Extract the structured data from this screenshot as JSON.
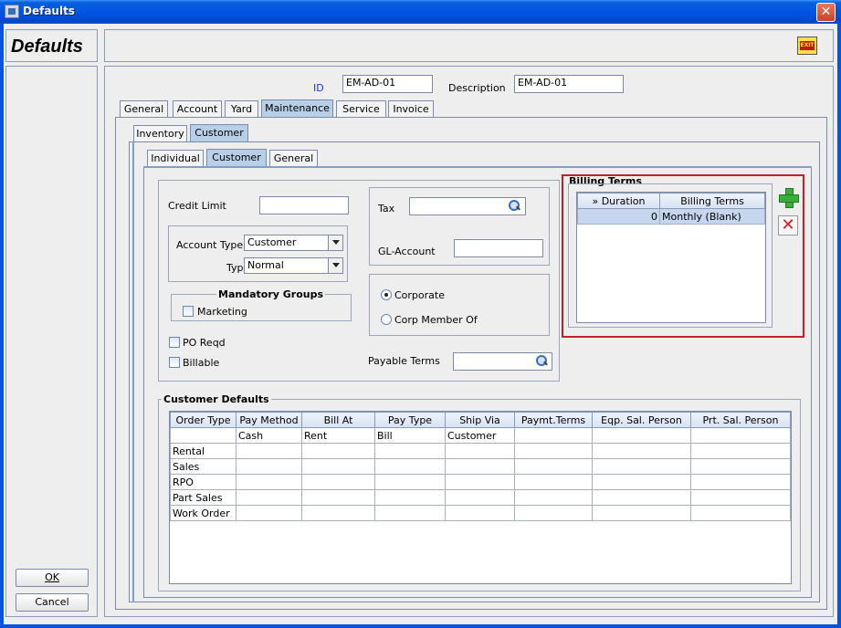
{
  "window": {
    "title": "Defaults"
  },
  "header": {
    "form_title": "Defaults",
    "exit_label": "EXIT"
  },
  "left": {
    "ok_label": "OK",
    "cancel_label": "Cancel"
  },
  "record": {
    "id_label": "ID",
    "id_value": "EM-AD-01",
    "description_label": "Description",
    "description_value": "EM-AD-01"
  },
  "main_tabs": [
    "General",
    "Account",
    "Yard",
    "Maintenance",
    "Service",
    "Invoice"
  ],
  "sub_tabs": [
    "Inventory",
    "Customer"
  ],
  "inner_tabs": [
    "Individual",
    "Customer",
    "General"
  ],
  "form": {
    "credit_limit_label": "Credit Limit",
    "credit_limit_value": "",
    "account_type_label": "Account Type",
    "account_type_value": "Customer",
    "type_label": "Type",
    "type_value": "Normal",
    "mandatory_groups_label": "Mandatory Groups",
    "marketing_label": "Marketing",
    "po_reqd_label": "PO Reqd",
    "billable_label": "Billable",
    "tax_label": "Tax",
    "tax_value": "",
    "gl_account_label": "GL-Account",
    "gl_account_value": "",
    "corporate_label": "Corporate",
    "corp_member_label": "Corp Member Of",
    "payable_terms_label": "Payable Terms",
    "payable_terms_value": ""
  },
  "billing_terms": {
    "title": "Billing Terms",
    "columns": [
      "» Duration",
      "Billing Terms"
    ],
    "rows": [
      {
        "duration": "0",
        "terms": "Monthly (Blank)"
      }
    ]
  },
  "customer_defaults": {
    "title": "Customer Defaults",
    "columns": [
      "Order Type",
      "Pay Method",
      "Bill At",
      "Pay Type",
      "Ship Via",
      "Paymt.Terms",
      "Eqp. Sal. Person",
      "Prt. Sal. Person"
    ],
    "rows": [
      [
        "",
        "Cash",
        "Rent",
        "Bill",
        "Customer",
        "",
        "",
        ""
      ],
      [
        "Rental",
        "",
        "",
        "",
        "",
        "",
        "",
        ""
      ],
      [
        "Sales",
        "",
        "",
        "",
        "",
        "",
        "",
        ""
      ],
      [
        "RPO",
        "",
        "",
        "",
        "",
        "",
        "",
        ""
      ],
      [
        "Part Sales",
        "",
        "",
        "",
        "",
        "",
        "",
        ""
      ],
      [
        "Work Order",
        "",
        "",
        "",
        "",
        "",
        "",
        ""
      ]
    ]
  }
}
